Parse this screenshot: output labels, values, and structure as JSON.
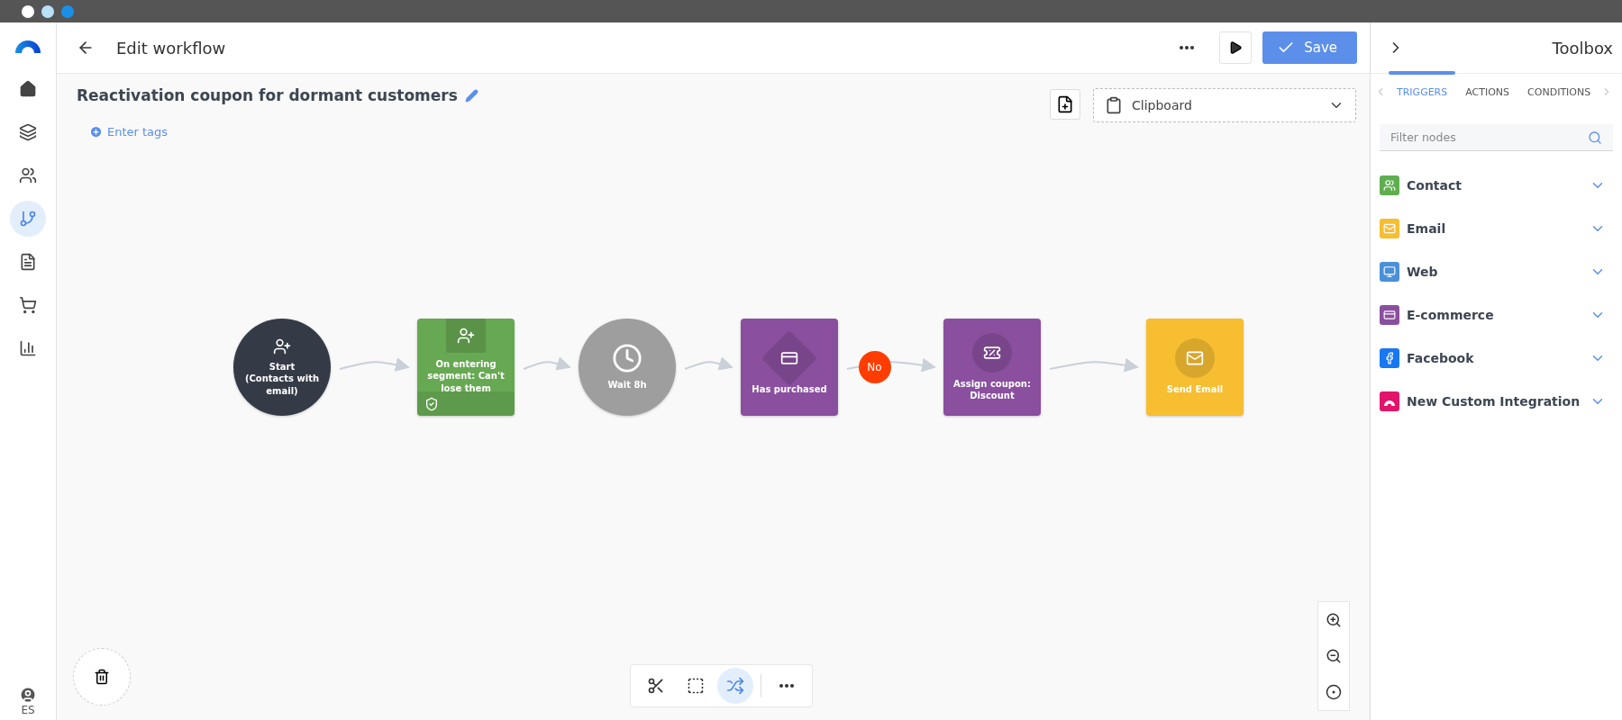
{
  "sidebar": {
    "items": [
      {
        "kind": "home",
        "selected": false
      },
      {
        "kind": "layers",
        "selected": false
      },
      {
        "kind": "contacts",
        "selected": false
      },
      {
        "kind": "workflow",
        "selected": true
      },
      {
        "kind": "document",
        "selected": false
      },
      {
        "kind": "cart",
        "selected": false
      },
      {
        "kind": "chart",
        "selected": false
      }
    ],
    "user_label": "ES"
  },
  "header": {
    "title": "Edit workflow",
    "save_label": "Save"
  },
  "workflow": {
    "name": "Reactivation coupon for dormant customers",
    "tags_link": "Enter tags",
    "clipboard": "Clipboard"
  },
  "nodes": [
    {
      "kind": "start",
      "label": "Start\n(Contacts with email)",
      "color": "#343b46"
    },
    {
      "kind": "trigger",
      "label": "On entering segment: Can't lose them",
      "color": "#67a852"
    },
    {
      "kind": "wait",
      "label": "Wait 8h",
      "color": "#9e9e9e"
    },
    {
      "kind": "condition",
      "label": "Has purchased",
      "color": "#8a4f9e",
      "branch_label": "No"
    },
    {
      "kind": "action",
      "label": "Assign coupon: Discount",
      "color": "#8a4f9e"
    },
    {
      "kind": "message",
      "label": "Send Email",
      "color": "#f6be30"
    }
  ],
  "canvas_tools": [
    {
      "kind": "cut",
      "selected": false
    },
    {
      "kind": "select",
      "selected": false
    },
    {
      "kind": "shuffle",
      "selected": true
    },
    {
      "kind": "more",
      "selected": false
    }
  ],
  "toolbox": {
    "title": "Toolbox",
    "tabs": [
      {
        "label": "TRIGGERS",
        "selected": true
      },
      {
        "label": "ACTIONS",
        "selected": false
      },
      {
        "label": "CONDITIONS",
        "selected": false
      }
    ],
    "filter_placeholder": "Filter nodes",
    "categories": [
      {
        "label": "Contact",
        "color": "#5fae4f",
        "kind": "contact"
      },
      {
        "label": "Email",
        "color": "#f6be30",
        "kind": "email"
      },
      {
        "label": "Web",
        "color": "#4a90d9",
        "kind": "web"
      },
      {
        "label": "E-commerce",
        "color": "#8a4f9e",
        "kind": "ecommerce"
      },
      {
        "label": "Facebook",
        "color": "#1877f2",
        "kind": "facebook"
      },
      {
        "label": "New Custom Integration",
        "color": "#e2156b",
        "kind": "custom"
      }
    ]
  }
}
